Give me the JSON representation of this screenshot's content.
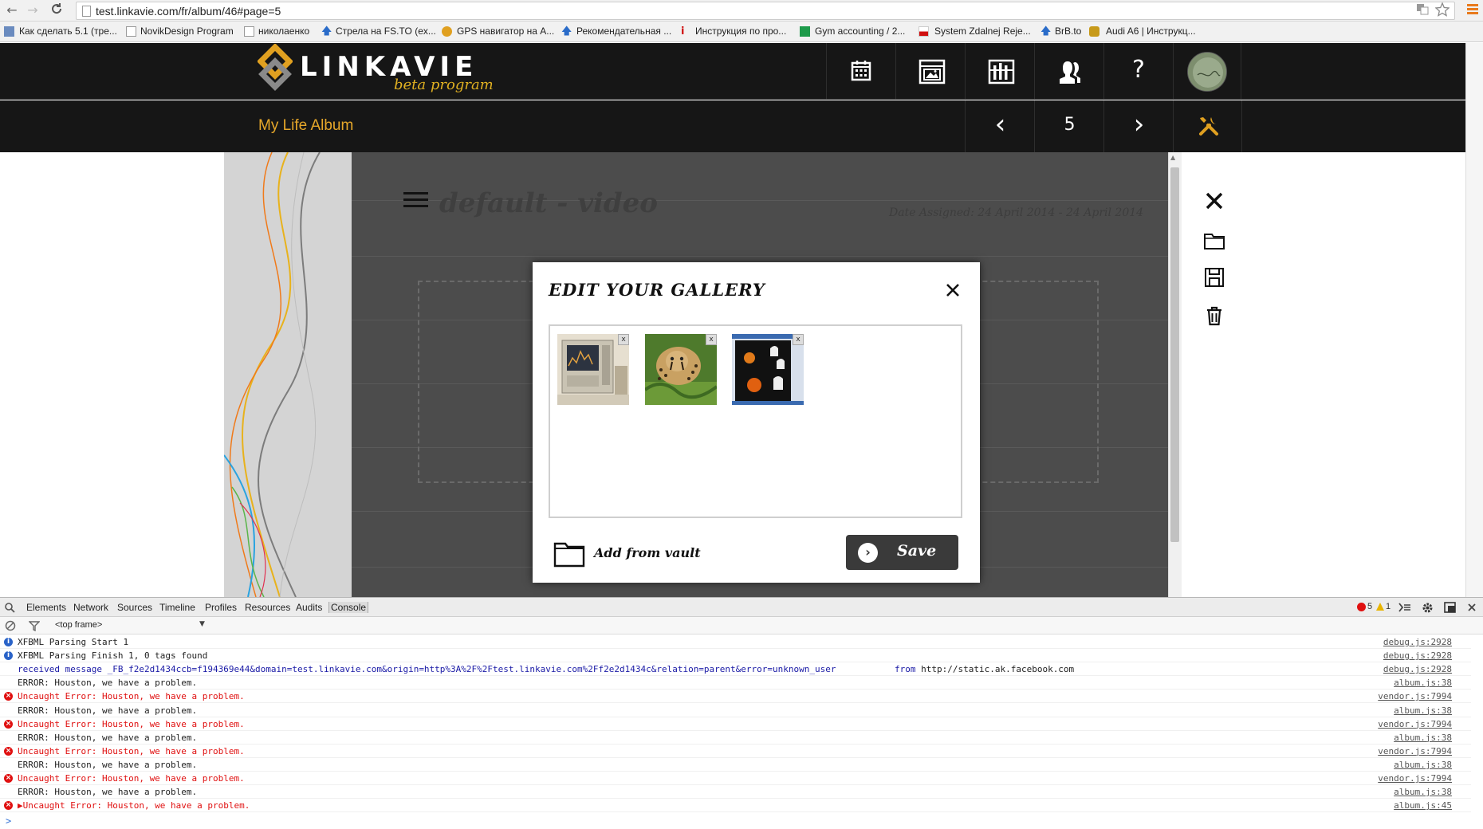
{
  "browser": {
    "url": "test.linkavie.com/fr/album/46#page=5",
    "back_glyph": "←",
    "forward_glyph": "→",
    "reload_glyph": "C",
    "bookmarks": [
      {
        "label": "Как сделать 5.1 (тре...",
        "icon": "page-icon"
      },
      {
        "label": "NovikDesign Program",
        "icon": "page-icon"
      },
      {
        "label": "николаенко",
        "icon": "page-icon"
      },
      {
        "label": "Стрела на FS.TO (ex...",
        "icon": "arrow-icon"
      },
      {
        "label": "GPS навигатор на A...",
        "icon": "gps-icon"
      },
      {
        "label": "Рекомендательная ...",
        "icon": "arrow-icon"
      },
      {
        "label": "Инструкция по про...",
        "icon": "info-icon"
      },
      {
        "label": "Gym accounting / 2...",
        "icon": "sheet-icon"
      },
      {
        "label": "System Zdalnej Reje...",
        "icon": "flag-icon"
      },
      {
        "label": "BrB.to",
        "icon": "arrow-icon"
      },
      {
        "label": "Audi A6 | Инструкц...",
        "icon": "car-icon"
      }
    ]
  },
  "site": {
    "logo_text": "LINKAVIE",
    "logo_sub": "beta program",
    "help_glyph": "?",
    "album_title": "My Life Album",
    "page_number": "5",
    "prev_glyph": "‹",
    "next_glyph": "›",
    "accent": "#e6a72a"
  },
  "page": {
    "title": "default - video",
    "date_assigned": "Date Assigned: 24 April 2014 - 24 April 2014"
  },
  "modal": {
    "title": "EDIT YOUR GALLERY",
    "thumb_close": "x",
    "thumbnails": [
      {
        "name": "monitor-device-photo"
      },
      {
        "name": "cheetah-photo"
      },
      {
        "name": "halloween-screenshot"
      }
    ],
    "vault_label": "Add from vault",
    "save_label": "Save",
    "save_glyph": "›"
  },
  "devtools": {
    "tabs": [
      "Elements",
      "Network",
      "Sources",
      "Timeline",
      "Profiles",
      "Resources",
      "Audits",
      "Console"
    ],
    "active_tab": "Console",
    "frame": "<top frame>",
    "error_count": "5",
    "warning_count": "1",
    "logs": [
      {
        "type": "info",
        "text": "XFBML Parsing Start 1",
        "source": "debug.js:2928"
      },
      {
        "type": "info",
        "text": "XFBML Parsing Finish 1, 0 tags found",
        "source": "debug.js:2928"
      },
      {
        "type": "message",
        "text": "received message _FB_f2e2d1434ccb=f194369e44&domain=test.linkavie.com&origin=http%3A%2F%2Ftest.linkavie.com%2Ff2e2d1434c&relation=parent&error=unknown_user",
        "from": "from",
        "from_url": "http://static.ak.facebook.com",
        "source": "debug.js:2928"
      },
      {
        "type": "plain",
        "text": "ERROR: Houston, we have a problem.",
        "source": "album.js:38"
      },
      {
        "type": "error",
        "text": "Uncaught Error: Houston, we have a problem.",
        "source": "vendor.js:7994"
      },
      {
        "type": "plain",
        "text": "ERROR: Houston, we have a problem.",
        "source": "album.js:38"
      },
      {
        "type": "error",
        "text": "Uncaught Error: Houston, we have a problem.",
        "source": "vendor.js:7994"
      },
      {
        "type": "plain",
        "text": "ERROR: Houston, we have a problem.",
        "source": "album.js:38"
      },
      {
        "type": "error",
        "text": "Uncaught Error: Houston, we have a problem.",
        "source": "vendor.js:7994"
      },
      {
        "type": "plain",
        "text": "ERROR: Houston, we have a problem.",
        "source": "album.js:38"
      },
      {
        "type": "error",
        "text": "Uncaught Error: Houston, we have a problem.",
        "source": "vendor.js:7994"
      },
      {
        "type": "plain",
        "text": "ERROR: Houston, we have a problem.",
        "source": "album.js:38"
      },
      {
        "type": "error",
        "text": "▶Uncaught Error: Houston, we have a problem.",
        "source": "album.js:45"
      }
    ],
    "prompt": ">"
  }
}
